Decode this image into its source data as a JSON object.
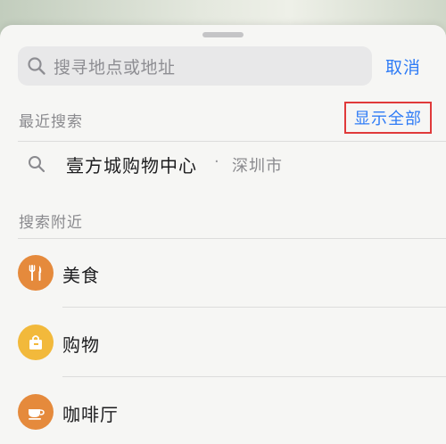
{
  "search": {
    "placeholder": "搜寻地点或地址",
    "cancel_label": "取消"
  },
  "recent": {
    "title": "最近搜索",
    "show_all_label": "显示全部",
    "items": [
      {
        "name": "壹方城购物中心",
        "separator": "·",
        "city": "深圳市",
        "icon": "magnifier-icon"
      }
    ]
  },
  "nearby": {
    "title": "搜索附近",
    "categories": [
      {
        "label": "美食",
        "icon": "fork-knife-icon",
        "color": "#e58a3c"
      },
      {
        "label": "购物",
        "icon": "shopping-bag-icon",
        "color": "#f2b93b"
      },
      {
        "label": "咖啡厅",
        "icon": "coffee-cup-icon",
        "color": "#e58a3c"
      }
    ]
  },
  "colors": {
    "accent": "#2f7cf6",
    "highlight_border": "#e03a3a"
  }
}
